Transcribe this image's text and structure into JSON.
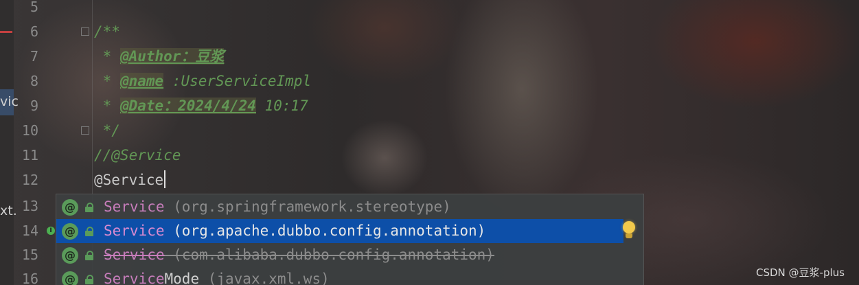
{
  "side_panel": {
    "label_top": "vic",
    "label_bottom": "xt."
  },
  "line_numbers": [
    "5",
    "6",
    "7",
    "8",
    "9",
    "10",
    "11",
    "12",
    "13",
    "14",
    "15",
    "16"
  ],
  "code": {
    "line6": "/**",
    "line7_prefix": " * ",
    "line7_tag": "@Author：豆浆",
    "line8_prefix": " * ",
    "line8_tag": "@name",
    "line8_rest": " :UserServiceImpl",
    "line9_prefix": " * ",
    "line9_tag": "@Date：2024/4/24",
    "line9_rest": " 10:17",
    "line10": " */",
    "line11": "//@Service",
    "line12": "@Service"
  },
  "autocomplete": {
    "items": [
      {
        "name": "Service",
        "package": " (org.springframework.stereotype)",
        "icon": "annotation-icon",
        "deprecated": false
      },
      {
        "name": "Service",
        "package": " (org.apache.dubbo.config.annotation)",
        "icon": "annotation-icon",
        "deprecated": false,
        "selected": true
      },
      {
        "name": "Service",
        "package": " (com.alibaba.dubbo.config.annotation)",
        "icon": "annotation-icon",
        "deprecated": true
      },
      {
        "name_match": "Service",
        "name_rest": "Mode",
        "package": " (javax.xml.ws)",
        "icon": "annotation-icon",
        "deprecated": false
      }
    ]
  },
  "icons": {
    "annotation": "@",
    "gutter_marker": "I"
  },
  "colors": {
    "selection": "#0d4fa8",
    "comment": "#629755",
    "match": "#c77dbb"
  },
  "watermark": "CSDN @豆浆-plus"
}
